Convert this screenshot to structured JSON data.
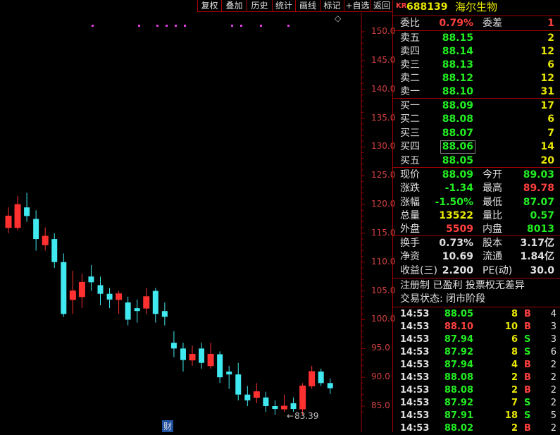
{
  "toolbar": {
    "buttons": [
      "复权",
      "叠加",
      "历史",
      "统计",
      "画线",
      "标记",
      "+自选",
      "返回"
    ],
    "diamond": "◇"
  },
  "stock": {
    "badge": "KR",
    "code": "688139",
    "name": "海尔生物"
  },
  "committee": {
    "ratio_label": "委比",
    "ratio": "0.79%",
    "diff_label": "委差",
    "diff": "1"
  },
  "sells": [
    {
      "label": "卖五",
      "price": "88.15",
      "vol": "2"
    },
    {
      "label": "卖四",
      "price": "88.14",
      "vol": "12"
    },
    {
      "label": "卖三",
      "price": "88.13",
      "vol": "6"
    },
    {
      "label": "卖二",
      "price": "88.12",
      "vol": "12"
    },
    {
      "label": "卖一",
      "price": "88.10",
      "vol": "31"
    }
  ],
  "buys": [
    {
      "label": "买一",
      "price": "88.09",
      "vol": "17"
    },
    {
      "label": "买二",
      "price": "88.08",
      "vol": "6"
    },
    {
      "label": "买三",
      "price": "88.07",
      "vol": "7"
    },
    {
      "label": "买四",
      "price": "88.06",
      "vol": "14"
    },
    {
      "label": "买五",
      "price": "88.05",
      "vol": "20"
    }
  ],
  "stats": [
    {
      "l1": "现价",
      "v1": "88.09",
      "c1": "g",
      "l2": "今开",
      "v2": "89.03",
      "c2": "g"
    },
    {
      "l1": "涨跌",
      "v1": "-1.34",
      "c1": "g",
      "l2": "最高",
      "v2": "89.78",
      "c2": "r"
    },
    {
      "l1": "涨幅",
      "v1": "-1.50%",
      "c1": "g",
      "l2": "最低",
      "v2": "87.07",
      "c2": "g"
    },
    {
      "l1": "总量",
      "v1": "13522",
      "c1": "y",
      "l2": "量比",
      "v2": "0.57",
      "c2": "g"
    },
    {
      "l1": "外盘",
      "v1": "5509",
      "c1": "r",
      "l2": "内盘",
      "v2": "8013",
      "c2": "g"
    }
  ],
  "fin": [
    {
      "l1": "换手",
      "v1": "0.73%",
      "l2": "股本",
      "v2": "3.17亿"
    },
    {
      "l1": "净资",
      "v1": "10.69",
      "l2": "流通",
      "v2": "1.84亿"
    },
    {
      "l1": "收益(三)",
      "v1": "2.200",
      "l2": "PE(动)",
      "v2": "30.0"
    }
  ],
  "info": {
    "line1": "注册制 已盈利 投票权无差异",
    "line2": "交易状态: 闭市阶段"
  },
  "ticks": [
    {
      "t": "14:53",
      "p": "88.05",
      "v": "8",
      "s": "B",
      "n": "4"
    },
    {
      "t": "14:53",
      "p": "88.10",
      "v": "10",
      "s": "B",
      "n": "3"
    },
    {
      "t": "14:53",
      "p": "87.94",
      "v": "6",
      "s": "S",
      "n": "3"
    },
    {
      "t": "14:53",
      "p": "87.92",
      "v": "8",
      "s": "S",
      "n": "6"
    },
    {
      "t": "14:53",
      "p": "87.94",
      "v": "4",
      "s": "B",
      "n": "2"
    },
    {
      "t": "14:53",
      "p": "88.08",
      "v": "2",
      "s": "B",
      "n": "2"
    },
    {
      "t": "14:53",
      "p": "88.08",
      "v": "2",
      "s": "B",
      "n": "2"
    },
    {
      "t": "14:53",
      "p": "87.92",
      "v": "7",
      "s": "S",
      "n": "2"
    },
    {
      "t": "14:53",
      "p": "87.91",
      "v": "18",
      "s": "S",
      "n": "5"
    },
    {
      "t": "14:53",
      "p": "88.02",
      "v": "2",
      "s": "B",
      "n": "2"
    }
  ],
  "chart_data": {
    "type": "candlestick",
    "y_ticks": [
      "150.0",
      "145.0",
      "140.0",
      "135.0",
      "130.0",
      "125.0",
      "120.0",
      "115.0",
      "110.0",
      "105.0",
      "100.0",
      "95.0",
      "90.0",
      "85.0"
    ],
    "ylim": [
      82.5,
      152.5
    ],
    "low_marker": "83.39",
    "bottom_marker": "财",
    "candles": [
      {
        "o": 116.0,
        "c": 118.0,
        "h": 119.5,
        "l": 115.0
      },
      {
        "o": 116.0,
        "c": 120.0,
        "h": 121.5,
        "l": 115.5
      },
      {
        "o": 119.5,
        "c": 118.0,
        "h": 122.0,
        "l": 117.0
      },
      {
        "o": 117.5,
        "c": 114.0,
        "h": 119.0,
        "l": 112.0
      },
      {
        "o": 113.0,
        "c": 114.5,
        "h": 116.0,
        "l": 112.0
      },
      {
        "o": 114.0,
        "c": 110.0,
        "h": 115.0,
        "l": 109.0
      },
      {
        "o": 110.0,
        "c": 101.0,
        "h": 111.5,
        "l": 100.5
      },
      {
        "o": 103.5,
        "c": 105.0,
        "h": 108.5,
        "l": 101.0
      },
      {
        "o": 104.0,
        "c": 106.5,
        "h": 108.0,
        "l": 102.0
      },
      {
        "o": 107.5,
        "c": 106.5,
        "h": 109.5,
        "l": 105.0
      },
      {
        "o": 106.0,
        "c": 104.5,
        "h": 107.5,
        "l": 102.5
      },
      {
        "o": 104.5,
        "c": 103.5,
        "h": 105.5,
        "l": 102.0
      },
      {
        "o": 103.5,
        "c": 104.5,
        "h": 105.0,
        "l": 101.0
      },
      {
        "o": 103.0,
        "c": 100.0,
        "h": 104.0,
        "l": 99.0
      },
      {
        "o": 102.0,
        "c": 101.5,
        "h": 103.5,
        "l": 99.5
      },
      {
        "o": 102.0,
        "c": 104.0,
        "h": 105.5,
        "l": 101.0
      },
      {
        "o": 105.0,
        "c": 101.0,
        "h": 105.5,
        "l": 99.5
      },
      {
        "o": 101.5,
        "c": 100.5,
        "h": 103.0,
        "l": 99.0
      },
      {
        "o": 96.0,
        "c": 95.0,
        "h": 98.0,
        "l": 93.5
      },
      {
        "o": 95.0,
        "c": 93.0,
        "h": 96.0,
        "l": 91.0
      },
      {
        "o": 93.0,
        "c": 94.0,
        "h": 95.5,
        "l": 92.0
      },
      {
        "o": 95.0,
        "c": 92.5,
        "h": 96.0,
        "l": 91.5
      },
      {
        "o": 92.0,
        "c": 94.0,
        "h": 96.0,
        "l": 91.5
      },
      {
        "o": 94.0,
        "c": 90.0,
        "h": 94.5,
        "l": 89.0
      },
      {
        "o": 91.0,
        "c": 90.5,
        "h": 92.0,
        "l": 88.0
      },
      {
        "o": 90.5,
        "c": 87.0,
        "h": 92.5,
        "l": 86.0
      },
      {
        "o": 87.0,
        "c": 86.0,
        "h": 88.5,
        "l": 85.0
      },
      {
        "o": 86.5,
        "c": 87.5,
        "h": 89.0,
        "l": 85.5
      },
      {
        "o": 86.5,
        "c": 85.0,
        "h": 87.5,
        "l": 84.0
      },
      {
        "o": 85.0,
        "c": 84.5,
        "h": 86.0,
        "l": 83.5
      },
      {
        "o": 84.5,
        "c": 85.0,
        "h": 87.0,
        "l": 84.0
      },
      {
        "o": 85.5,
        "c": 84.5,
        "h": 86.5,
        "l": 84.0
      },
      {
        "o": 84.5,
        "c": 88.5,
        "h": 89.0,
        "l": 83.4
      },
      {
        "o": 88.5,
        "c": 91.0,
        "h": 92.0,
        "l": 88.0
      },
      {
        "o": 91.0,
        "c": 89.0,
        "h": 91.5,
        "l": 88.5
      },
      {
        "o": 89.0,
        "c": 88.1,
        "h": 89.8,
        "l": 87.1
      }
    ],
    "markers": [
      130,
      196,
      222,
      235,
      248,
      261,
      328,
      341,
      369,
      408
    ]
  }
}
